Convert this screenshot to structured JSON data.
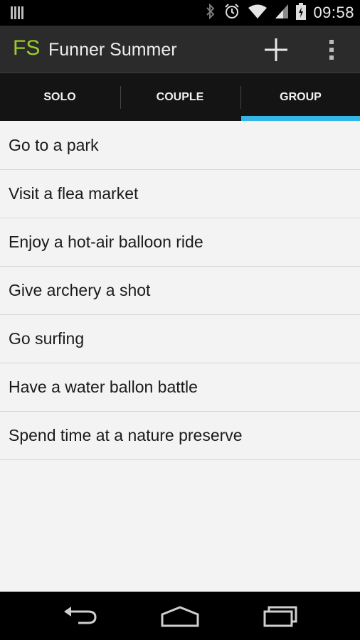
{
  "status_bar": {
    "time": "09:58",
    "icons": [
      "notification-icon",
      "bluetooth-icon",
      "alarm-icon",
      "wifi-icon",
      "cell-signal-icon",
      "battery-icon"
    ]
  },
  "action_bar": {
    "logo": "FS",
    "title": "Funner Summer",
    "logo_color": "#9ccc2b"
  },
  "tabs": [
    {
      "label": "SOLO",
      "selected": false
    },
    {
      "label": "COUPLE",
      "selected": false
    },
    {
      "label": "GROUP",
      "selected": true
    }
  ],
  "accent_color": "#33b5e5",
  "items": [
    {
      "label": "Go to a park"
    },
    {
      "label": "Visit a flea market"
    },
    {
      "label": "Enjoy a hot-air balloon ride"
    },
    {
      "label": "Give archery a shot"
    },
    {
      "label": "Go surfing"
    },
    {
      "label": "Have a water ballon battle"
    },
    {
      "label": "Spend time at a nature preserve"
    }
  ],
  "nav_bar": {
    "buttons": [
      "back-icon",
      "home-icon",
      "recent-apps-icon"
    ]
  }
}
